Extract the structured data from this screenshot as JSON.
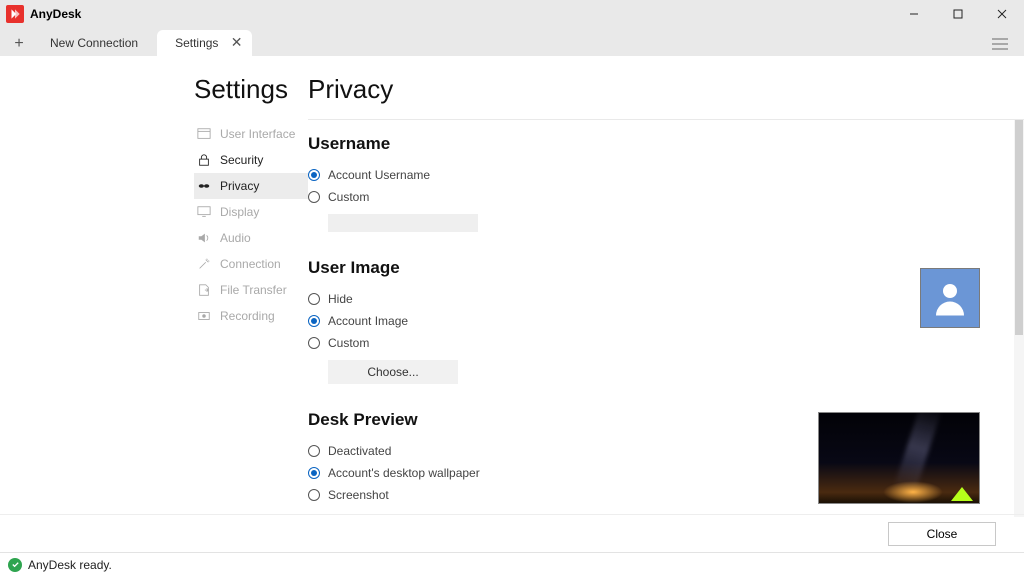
{
  "app": {
    "title": "AnyDesk"
  },
  "window": {
    "minimize": "–",
    "maximize": "▢",
    "close": "✕"
  },
  "tabs": {
    "new_connection": "New Connection",
    "settings": "Settings"
  },
  "sidebar": {
    "heading": "Settings",
    "items": [
      {
        "label": "User Interface"
      },
      {
        "label": "Security"
      },
      {
        "label": "Privacy"
      },
      {
        "label": "Display"
      },
      {
        "label": "Audio"
      },
      {
        "label": "Connection"
      },
      {
        "label": "File Transfer"
      },
      {
        "label": "Recording"
      }
    ]
  },
  "page": {
    "heading": "Privacy",
    "username": {
      "heading": "Username",
      "opt_account": "Account Username",
      "opt_custom": "Custom"
    },
    "userimage": {
      "heading": "User Image",
      "opt_hide": "Hide",
      "opt_account": "Account Image",
      "opt_custom": "Custom",
      "choose": "Choose..."
    },
    "deskpreview": {
      "heading": "Desk Preview",
      "opt_deactivated": "Deactivated",
      "opt_wallpaper": "Account's desktop wallpaper",
      "opt_screenshot": "Screenshot"
    },
    "close": "Close"
  },
  "status": {
    "text": "AnyDesk ready."
  }
}
